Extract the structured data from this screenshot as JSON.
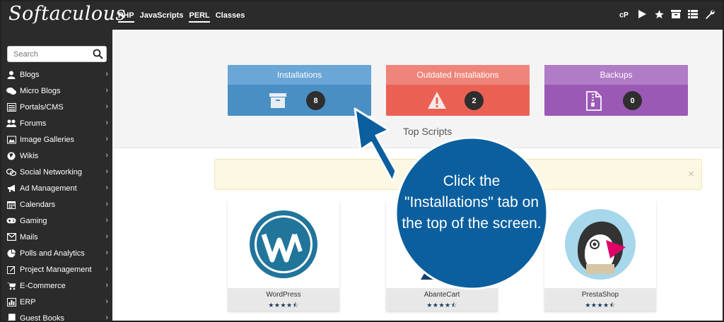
{
  "app": {
    "logo": "Softaculous"
  },
  "top_tabs": [
    {
      "label": "PHP",
      "active": true
    },
    {
      "label": "JavaScripts",
      "active": false
    },
    {
      "label": "PERL",
      "active": true
    },
    {
      "label": "Classes",
      "active": false
    }
  ],
  "top_icons": [
    "cpanel-icon",
    "play-icon",
    "star-icon",
    "archive-icon",
    "list-icon",
    "wrench-icon"
  ],
  "search": {
    "placeholder": "Search",
    "value": ""
  },
  "sidebar": {
    "items": [
      {
        "label": "Blogs",
        "icon": "user-icon"
      },
      {
        "label": "Micro Blogs",
        "icon": "comments-icon"
      },
      {
        "label": "Portals/CMS",
        "icon": "list-box-icon"
      },
      {
        "label": "Forums",
        "icon": "users-icon"
      },
      {
        "label": "Image Galleries",
        "icon": "image-icon"
      },
      {
        "label": "Wikis",
        "icon": "globe-icon"
      },
      {
        "label": "Social Networking",
        "icon": "chat-icon"
      },
      {
        "label": "Ad Management",
        "icon": "megaphone-icon"
      },
      {
        "label": "Calendars",
        "icon": "calendar-icon"
      },
      {
        "label": "Gaming",
        "icon": "gamepad-icon"
      },
      {
        "label": "Mails",
        "icon": "envelope-icon"
      },
      {
        "label": "Polls and Analytics",
        "icon": "pie-chart-icon"
      },
      {
        "label": "Project Management",
        "icon": "edit-icon"
      },
      {
        "label": "E-Commerce",
        "icon": "cart-icon"
      },
      {
        "label": "ERP",
        "icon": "bar-chart-icon"
      },
      {
        "label": "Guest Books",
        "icon": "book-icon"
      }
    ]
  },
  "cards": [
    {
      "title": "Installations",
      "count": "8",
      "color": "#4a8fc4",
      "title_color": "#6aa6d6"
    },
    {
      "title": "Outdated Installations",
      "count": "2",
      "color": "#ea6154",
      "title_color": "#ef847a"
    },
    {
      "title": "Backups",
      "count": "0",
      "color": "#9b59b6",
      "title_color": "#b07cc6"
    }
  ],
  "top_scripts": {
    "title": "Top Scripts",
    "items": [
      {
        "name": "WordPress",
        "stars": "★★★★⯪"
      },
      {
        "name": "AbanteCart",
        "stars": "★★★★⯪"
      },
      {
        "name": "PrestaShop",
        "stars": "★★★★⯪"
      }
    ]
  },
  "callout": {
    "text": "Click the \"Installations\" tab on the top of the screen.",
    "color": "#0b5f9e"
  },
  "notice": {
    "close": "×"
  }
}
